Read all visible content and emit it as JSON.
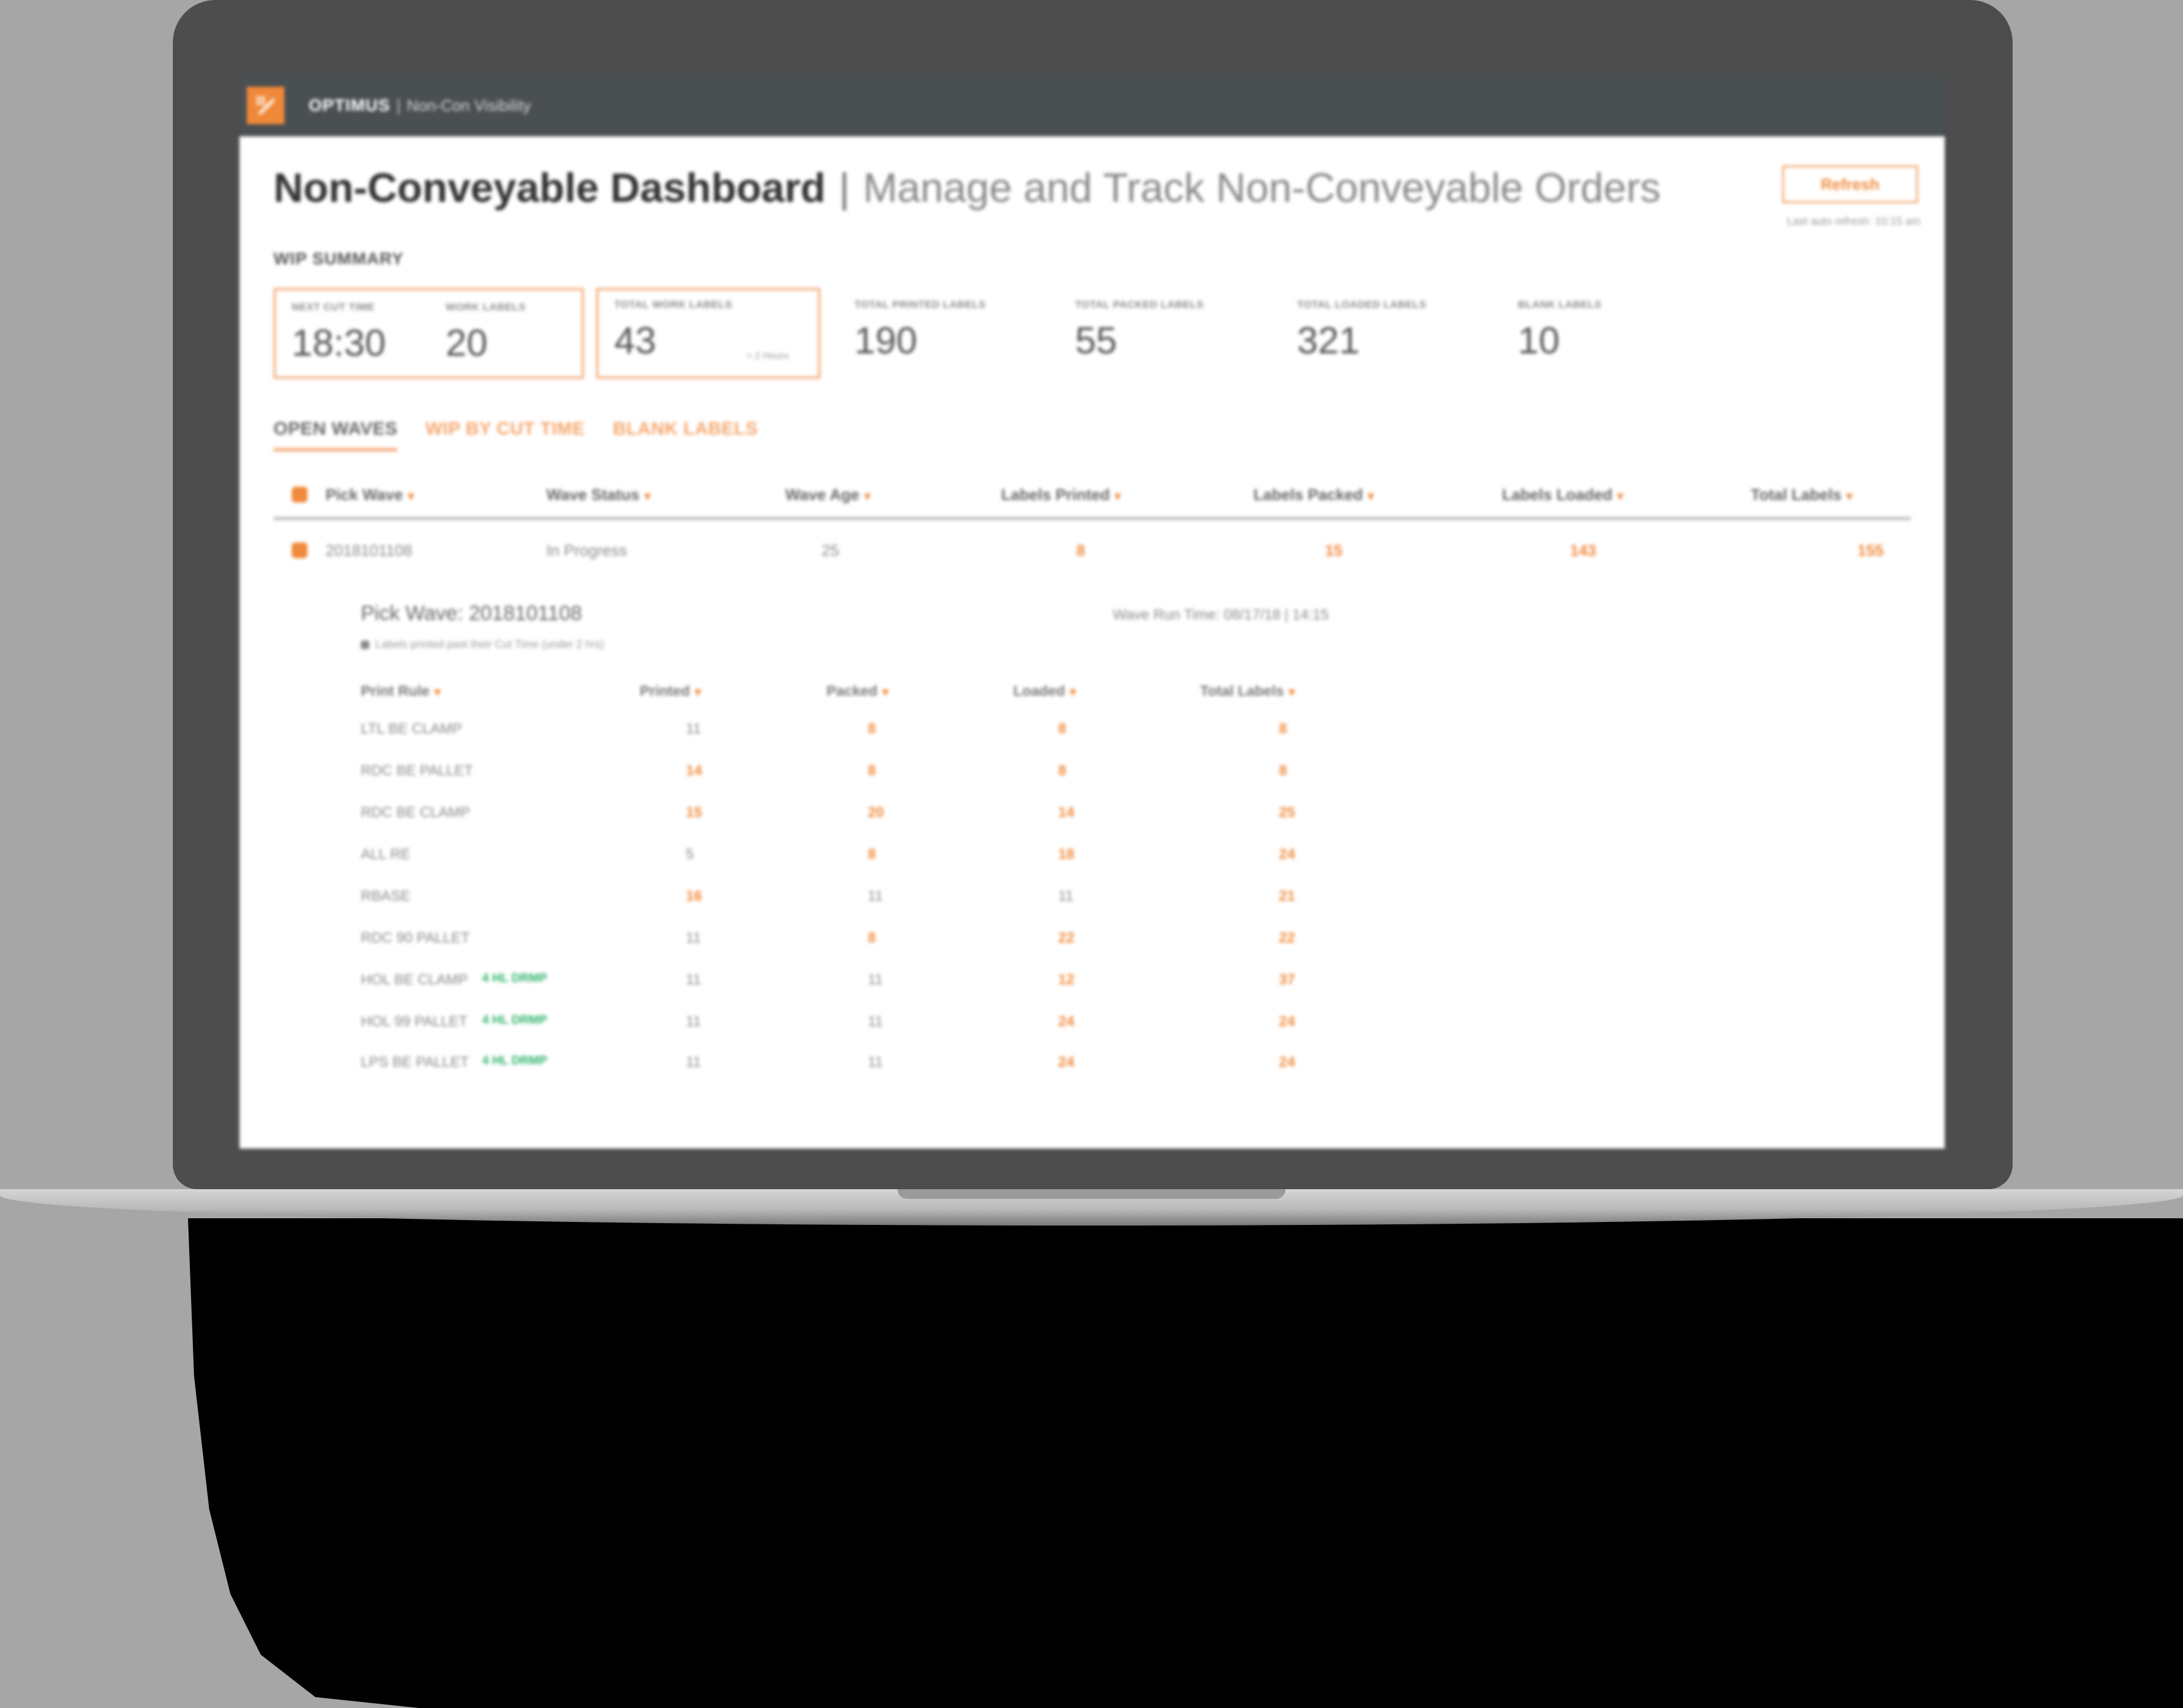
{
  "app": {
    "brand": "OPTIMUS",
    "brand_separator": "|",
    "brand_subtitle": "Non-Con Visibility",
    "accent_color": "#f08a3c",
    "header_color": "#4a4f52"
  },
  "header": {
    "title": "Non-Conveyable Dashboard",
    "separator": "|",
    "subtitle": "Manage and Track Non-Conveyable Orders",
    "refresh_label": "Refresh",
    "last_update": "Last auto refresh: 10:15 am"
  },
  "wip_summary": {
    "label": "WIP SUMMARY",
    "kpis": [
      {
        "label": "NEXT CUT TIME",
        "value": "18:30"
      },
      {
        "label": "WORK LABELS",
        "value": "20"
      },
      {
        "label": "TOTAL WORK LABELS",
        "value": "43",
        "note": "> 2 Hours"
      },
      {
        "label": "TOTAL PRINTED LABELS",
        "value": "190"
      },
      {
        "label": "TOTAL PACKED LABELS",
        "value": "55"
      },
      {
        "label": "TOTAL LOADED LABELS",
        "value": "321"
      },
      {
        "label": "BLANK LABELS",
        "value": "10"
      }
    ]
  },
  "tabs": [
    {
      "label": "OPEN WAVES",
      "active": true
    },
    {
      "label": "WIP BY CUT TIME",
      "active": false
    },
    {
      "label": "BLANK LABELS",
      "active": false
    }
  ],
  "waves_table": {
    "columns": [
      "Pick Wave",
      "Wave Status",
      "Wave Age",
      "Labels Printed",
      "Labels Packed",
      "Labels Loaded",
      "Total Labels"
    ],
    "rows": [
      {
        "pick_wave": "2018101108",
        "status": "In Progress",
        "age": "25",
        "printed": "8",
        "packed": "15",
        "loaded": "143",
        "total": "155"
      }
    ]
  },
  "detail": {
    "title": "Pick Wave: 2018101108",
    "cut_time": "Wave Run Time: 08/17/18 | 14:15",
    "note": "Labels printed past their Cut Time (under 2 hrs)",
    "columns": [
      "Print Rule",
      "Printed",
      "Packed",
      "Loaded",
      "Total Labels"
    ],
    "rows": [
      {
        "rule": "LTL BE CLAMP",
        "tag": "",
        "printed": "11",
        "packed": "8",
        "loaded": "8",
        "total": "8"
      },
      {
        "rule": "RDC BE PALLET",
        "tag": "",
        "printed": "14",
        "packed": "8",
        "loaded": "8",
        "total": "8"
      },
      {
        "rule": "RDC BE CLAMP",
        "tag": "",
        "printed": "15",
        "packed": "20",
        "loaded": "14",
        "total": "25"
      },
      {
        "rule": "ALL RE",
        "tag": "",
        "printed": "5",
        "packed": "8",
        "loaded": "18",
        "total": "24"
      },
      {
        "rule": "RBASE",
        "tag": "",
        "printed": "16",
        "packed": "11",
        "loaded": "11",
        "total": "21"
      },
      {
        "rule": "RDC 90 PALLET",
        "tag": "",
        "printed": "11",
        "packed": "8",
        "loaded": "22",
        "total": "22"
      },
      {
        "rule": "HOL BE CLAMP",
        "tag": "4 HL DRMP",
        "printed": "11",
        "packed": "11",
        "loaded": "12",
        "total": "37"
      },
      {
        "rule": "HOL 99 PALLET",
        "tag": "4 HL DRMP",
        "printed": "11",
        "packed": "11",
        "loaded": "24",
        "total": "24"
      },
      {
        "rule": "LPS BE PALLET",
        "tag": "4 HL DRMP",
        "printed": "11",
        "packed": "11",
        "loaded": "24",
        "total": "24"
      }
    ]
  }
}
